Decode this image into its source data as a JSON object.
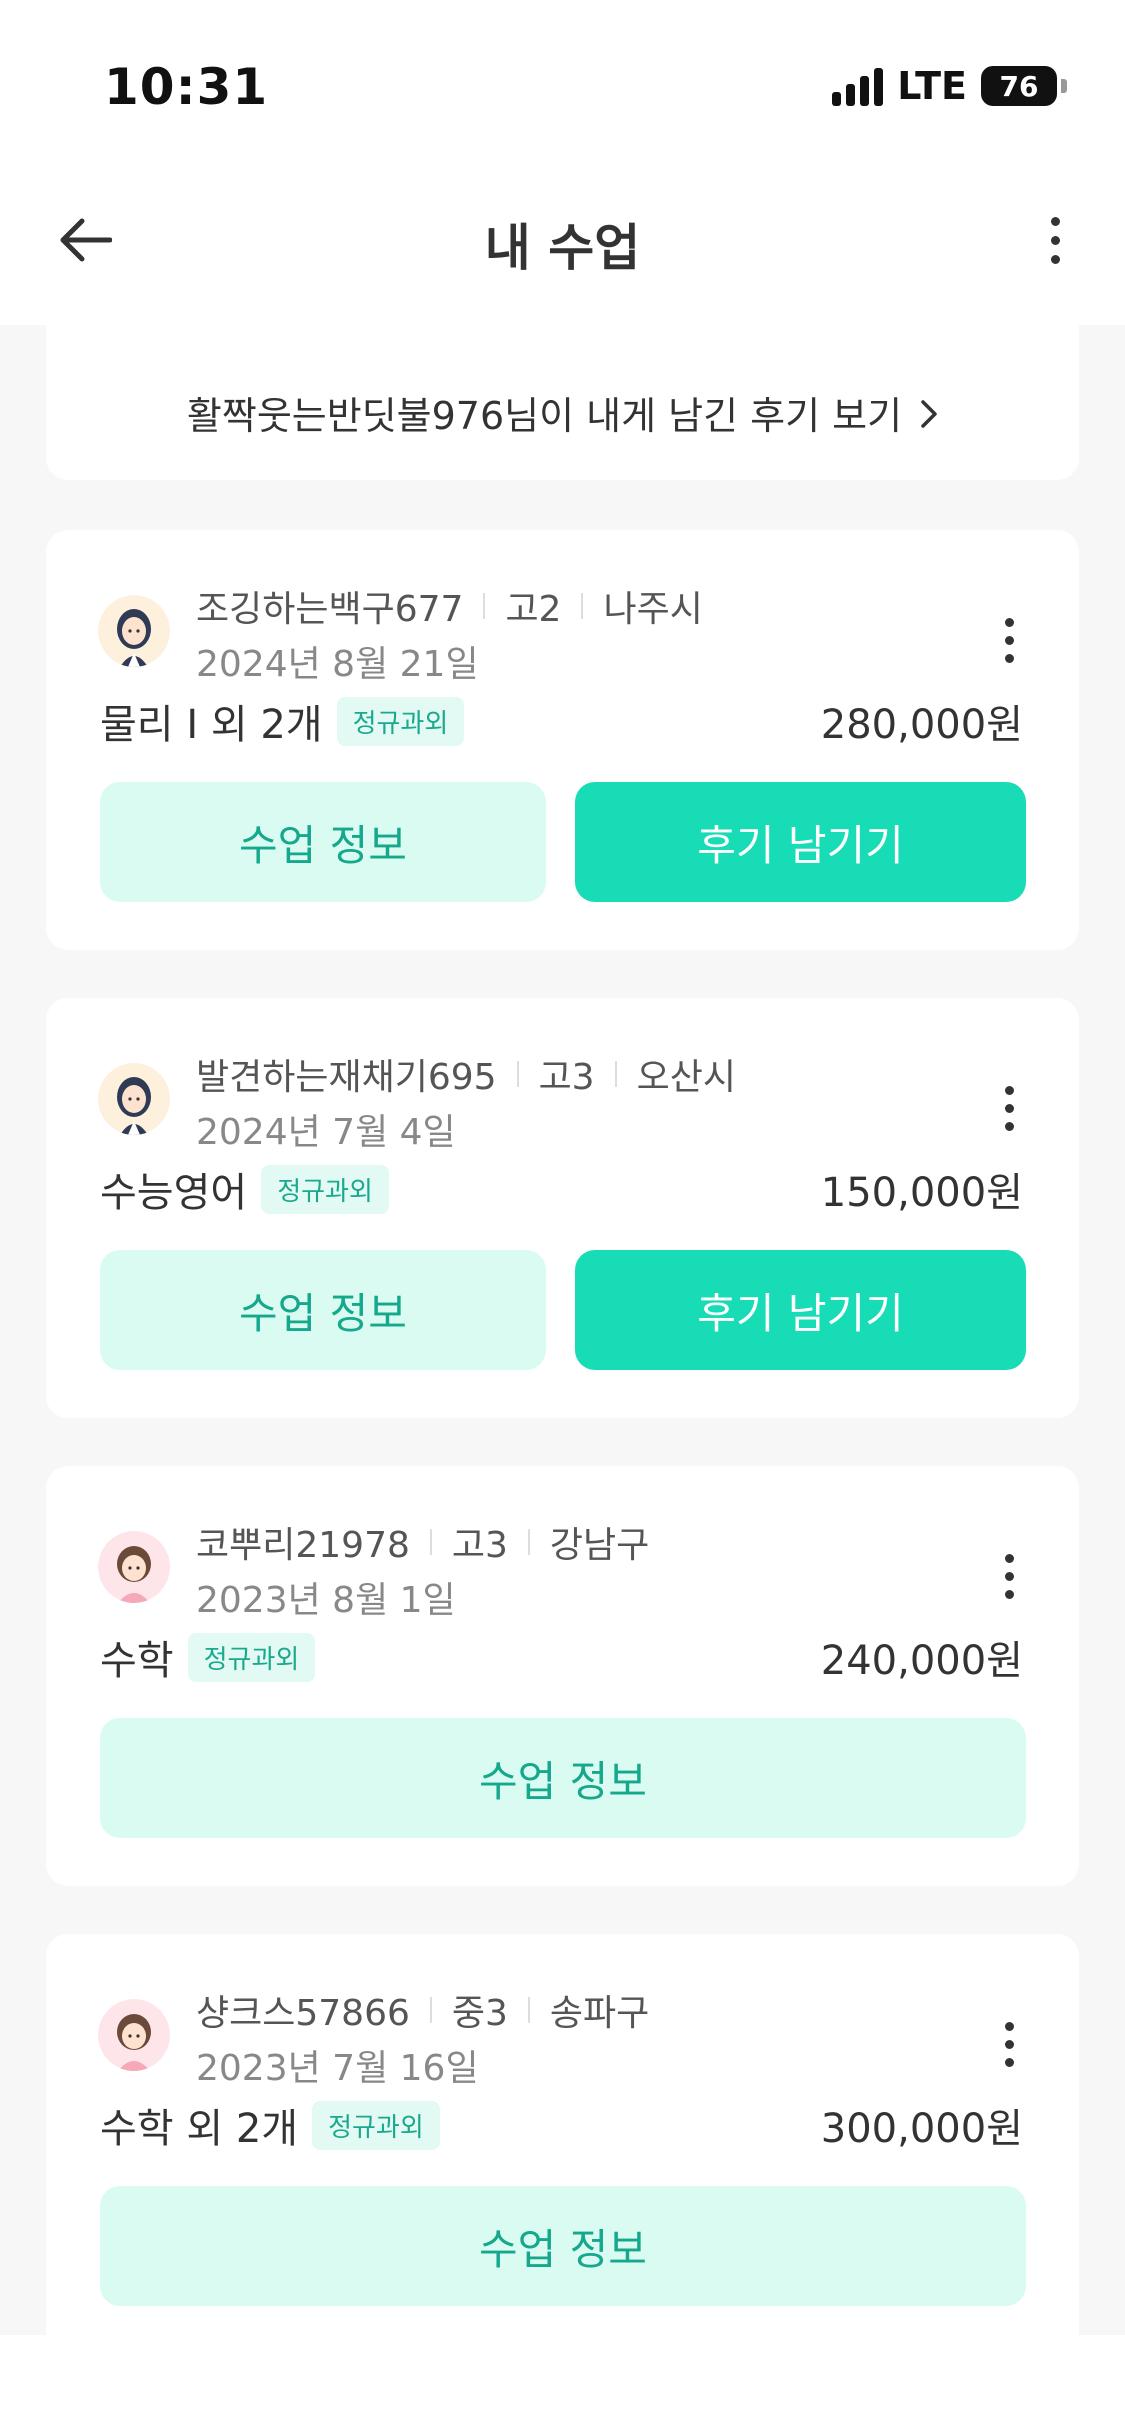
{
  "status_bar": {
    "time": "10:31",
    "network": "LTE",
    "battery": "76"
  },
  "nav": {
    "title": "내 수업"
  },
  "review_link": {
    "text": "활짝웃는반딧불976님이 내게 남긴 후기 보기"
  },
  "lessons": [
    {
      "name": "조깅하는백구677",
      "grade": "고2",
      "region": "나주시",
      "date": "2024년 8월 21일",
      "subject": "물리 I 외 2개",
      "tag": "정규과외",
      "price": "280,000원",
      "info_label": "수업 정보",
      "review_label": "후기 남기기"
    },
    {
      "name": "발견하는재채기695",
      "grade": "고3",
      "region": "오산시",
      "date": "2024년 7월 4일",
      "subject": "수능영어",
      "tag": "정규과외",
      "price": "150,000원",
      "info_label": "수업 정보",
      "review_label": "후기 남기기"
    },
    {
      "name": "코뿌리21978",
      "grade": "고3",
      "region": "강남구",
      "date": "2023년 8월 1일",
      "subject": "수학",
      "tag": "정규과외",
      "price": "240,000원",
      "info_label": "수업 정보"
    },
    {
      "name": "샹크스57866",
      "grade": "중3",
      "region": "송파구",
      "date": "2023년 7월 16일",
      "subject": "수학 외 2개",
      "tag": "정규과외",
      "price": "300,000원",
      "info_label": "수업 정보"
    }
  ],
  "colors": {
    "accent": "#17dcb6",
    "accent_light": "#d9fbf1",
    "accent_text": "#16a88c",
    "background": "#f7f7f7"
  }
}
